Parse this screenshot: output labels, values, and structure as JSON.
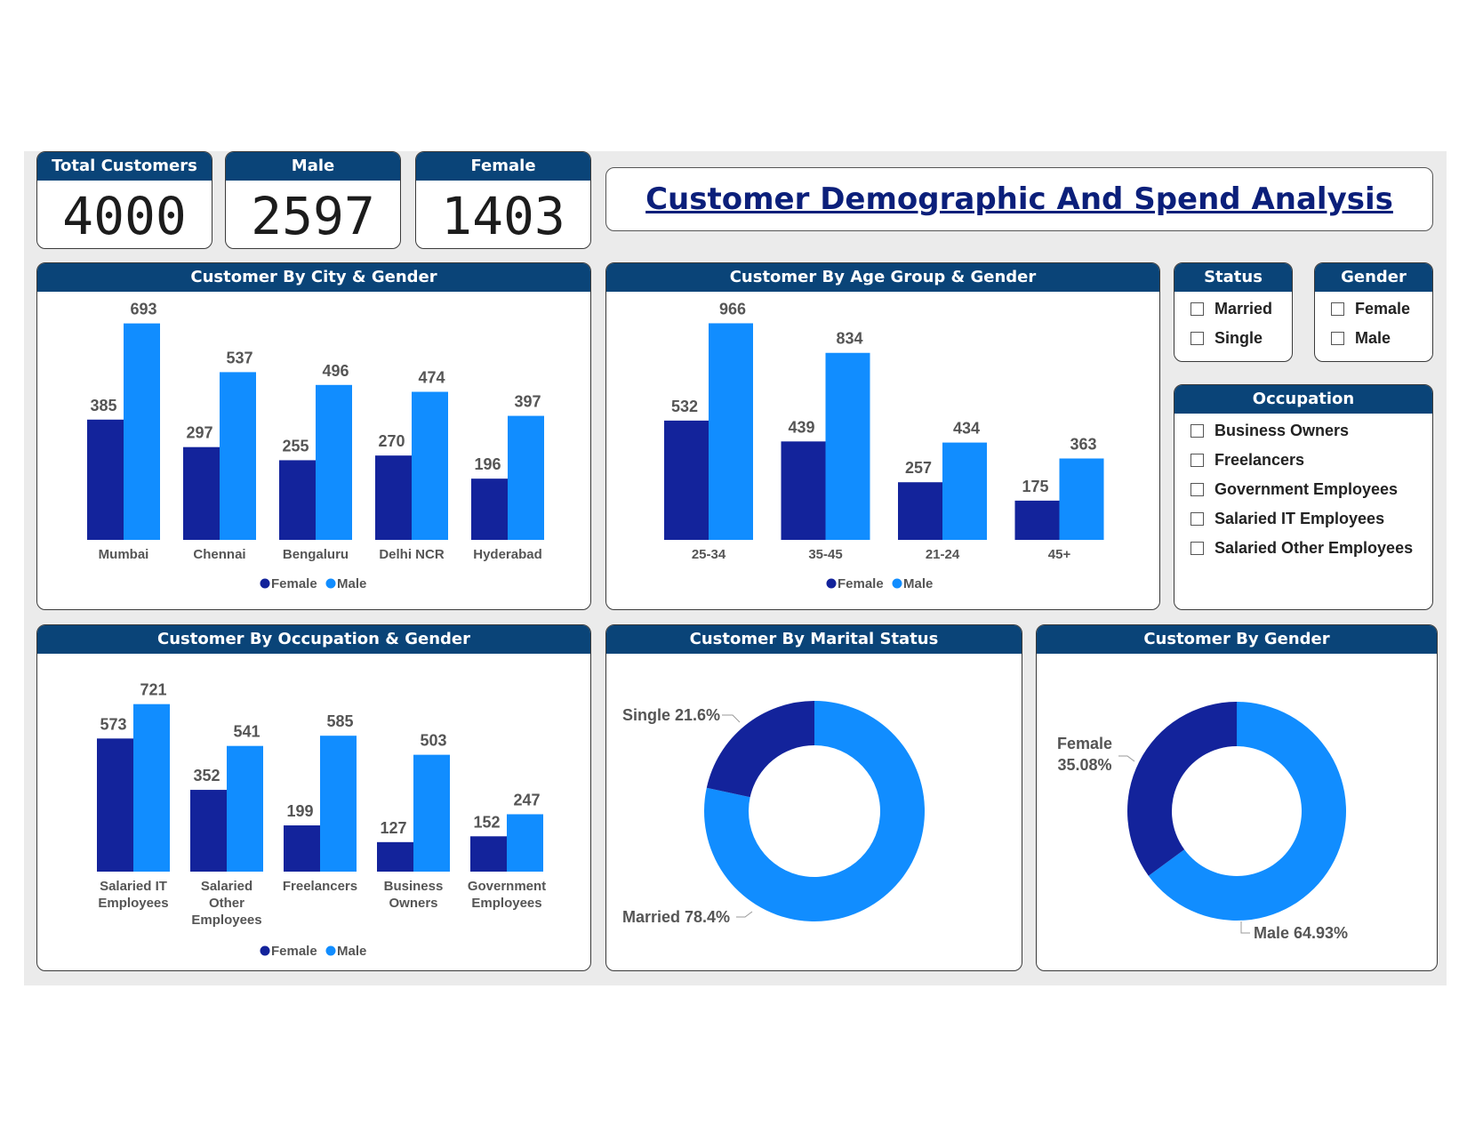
{
  "kpis": [
    {
      "label": "Total Customers",
      "value": "4000"
    },
    {
      "label": "Male",
      "value": "2597"
    },
    {
      "label": "Female",
      "value": "1403"
    }
  ],
  "title": "Customer Demographic And Spend Analysis",
  "colors": {
    "female": "#13239b",
    "male": "#118dff",
    "header": "#0a4478"
  },
  "legend": {
    "female": "Female",
    "male": "Male"
  },
  "city_chart": {
    "title": "Customer By City & Gender",
    "chart_data": {
      "type": "bar",
      "categories": [
        "Mumbai",
        "Chennai",
        "Bengaluru",
        "Delhi NCR",
        "Hyderabad"
      ],
      "series": [
        {
          "name": "Female",
          "values": [
            385,
            297,
            255,
            270,
            196
          ]
        },
        {
          "name": "Male",
          "values": [
            693,
            537,
            496,
            474,
            397
          ]
        }
      ]
    }
  },
  "age_chart": {
    "title": "Customer By Age Group & Gender",
    "chart_data": {
      "type": "bar",
      "categories": [
        "25-34",
        "35-45",
        "21-24",
        "45+"
      ],
      "series": [
        {
          "name": "Female",
          "values": [
            532,
            439,
            257,
            175
          ]
        },
        {
          "name": "Male",
          "values": [
            966,
            834,
            434,
            363
          ]
        }
      ]
    }
  },
  "occupation_chart": {
    "title": "Customer By Occupation & Gender",
    "chart_data": {
      "type": "bar",
      "categories": [
        "Salaried IT Employees",
        "Salaried Other Employees",
        "Freelancers",
        "Business Owners",
        "Government Employees"
      ],
      "category_lines": [
        [
          "Salaried IT",
          "Employees"
        ],
        [
          "Salaried",
          "Other",
          "Employees"
        ],
        [
          "Freelancers"
        ],
        [
          "Business",
          "Owners"
        ],
        [
          "Government",
          "Employees"
        ]
      ],
      "series": [
        {
          "name": "Female",
          "values": [
            573,
            352,
            199,
            127,
            152
          ]
        },
        {
          "name": "Male",
          "values": [
            721,
            541,
            585,
            503,
            247
          ]
        }
      ]
    }
  },
  "marital_chart": {
    "title": "Customer By Marital Status",
    "chart_data": {
      "type": "pie",
      "labels": [
        "Single",
        "Married"
      ],
      "values": [
        21.6,
        78.4
      ],
      "data_labels": [
        "Single 21.6%",
        "Married 78.4%"
      ]
    }
  },
  "gender_chart": {
    "title": "Customer By Gender",
    "chart_data": {
      "type": "pie",
      "labels": [
        "Female",
        "Male"
      ],
      "values": [
        35.08,
        64.93
      ],
      "data_labels": [
        "Female",
        "35.08%",
        "Male 64.93%"
      ]
    }
  },
  "slicers": {
    "status": {
      "title": "Status",
      "items": [
        "Married",
        "Single"
      ]
    },
    "gender": {
      "title": "Gender",
      "items": [
        "Female",
        "Male"
      ]
    },
    "occupation": {
      "title": "Occupation",
      "items": [
        "Business Owners",
        "Freelancers",
        "Government Employees",
        "Salaried IT Employees",
        "Salaried Other Employees"
      ]
    }
  }
}
